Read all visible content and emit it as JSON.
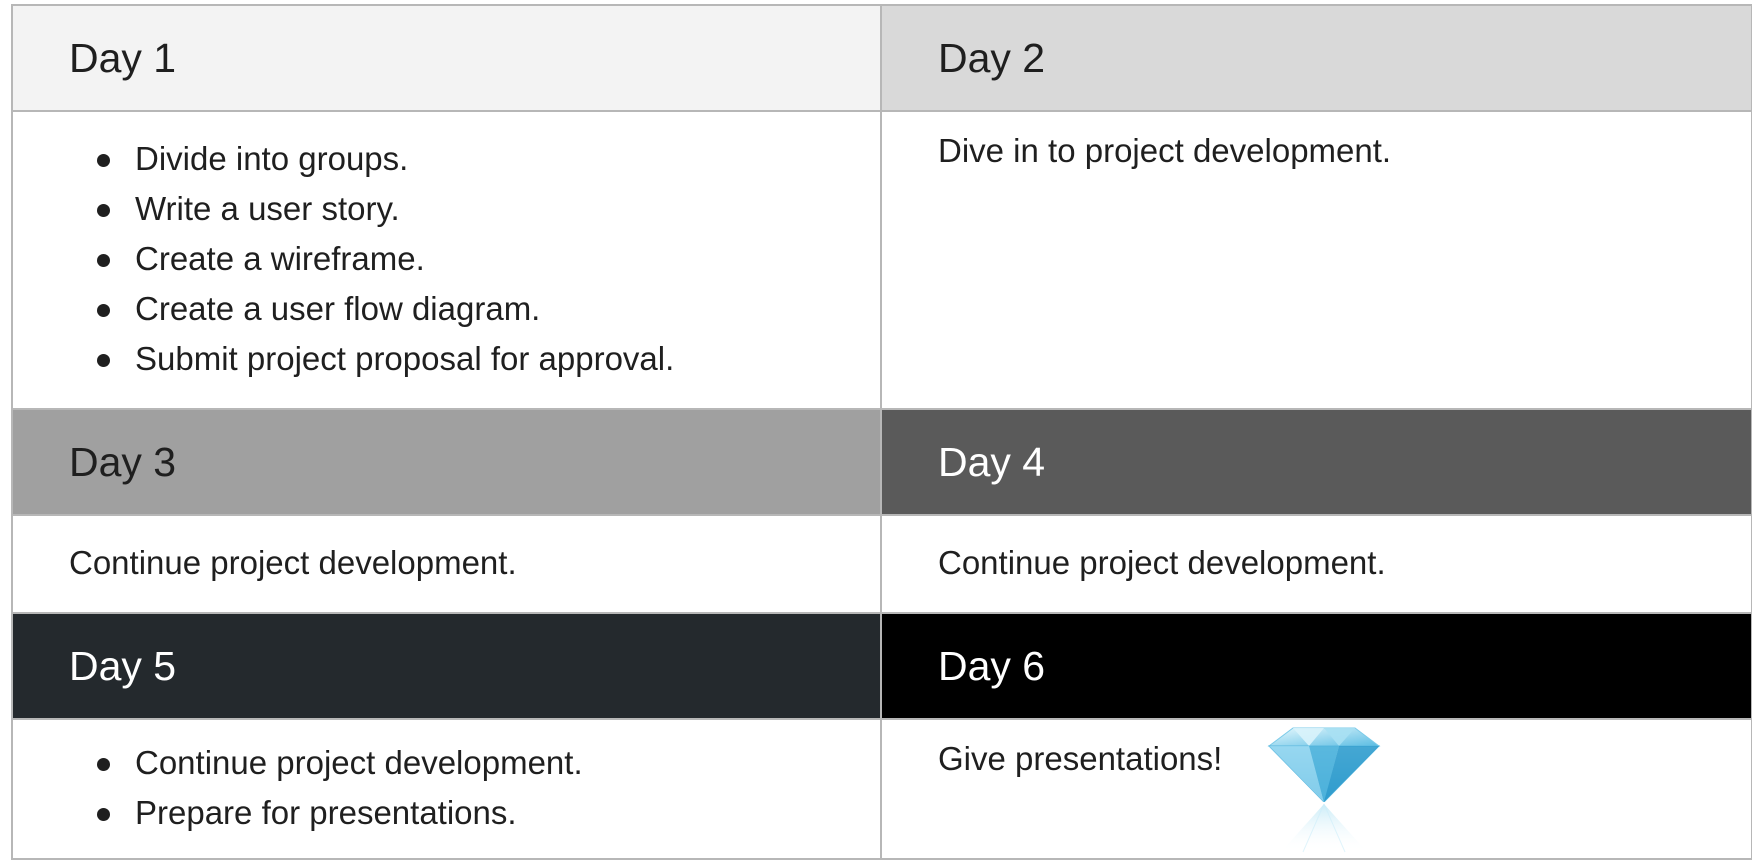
{
  "days": [
    {
      "label": "Day 1",
      "bg": "#f3f3f3",
      "fg": "#1f1f1f"
    },
    {
      "label": "Day 2",
      "bg": "#d9d9d9",
      "fg": "#1f1f1f"
    },
    {
      "label": "Day 3",
      "bg": "#a0a0a0",
      "fg": "#1f1f1f"
    },
    {
      "label": "Day 4",
      "bg": "#5a5a5a",
      "fg": "#ffffff"
    },
    {
      "label": "Day 5",
      "bg": "#24292d",
      "fg": "#ffffff"
    },
    {
      "label": "Day 6",
      "bg": "#000000",
      "fg": "#ffffff"
    }
  ],
  "day1_items": [
    "Divide into groups.",
    "Write a user story.",
    "Create a wireframe.",
    "Create a user flow diagram.",
    "Submit project proposal for approval."
  ],
  "day2_text": "Dive in to project development.",
  "day3_text": "Continue project development.",
  "day4_text": "Continue project development.",
  "day5_items": [
    "Continue project development.",
    "Prepare for presentations."
  ],
  "day6_text": "Give presentations!",
  "day6_icon": "diamond-icon",
  "colors": {
    "border": "#b7b7b7",
    "text": "#1f1f1f",
    "diamond": "#6ec6e8"
  }
}
